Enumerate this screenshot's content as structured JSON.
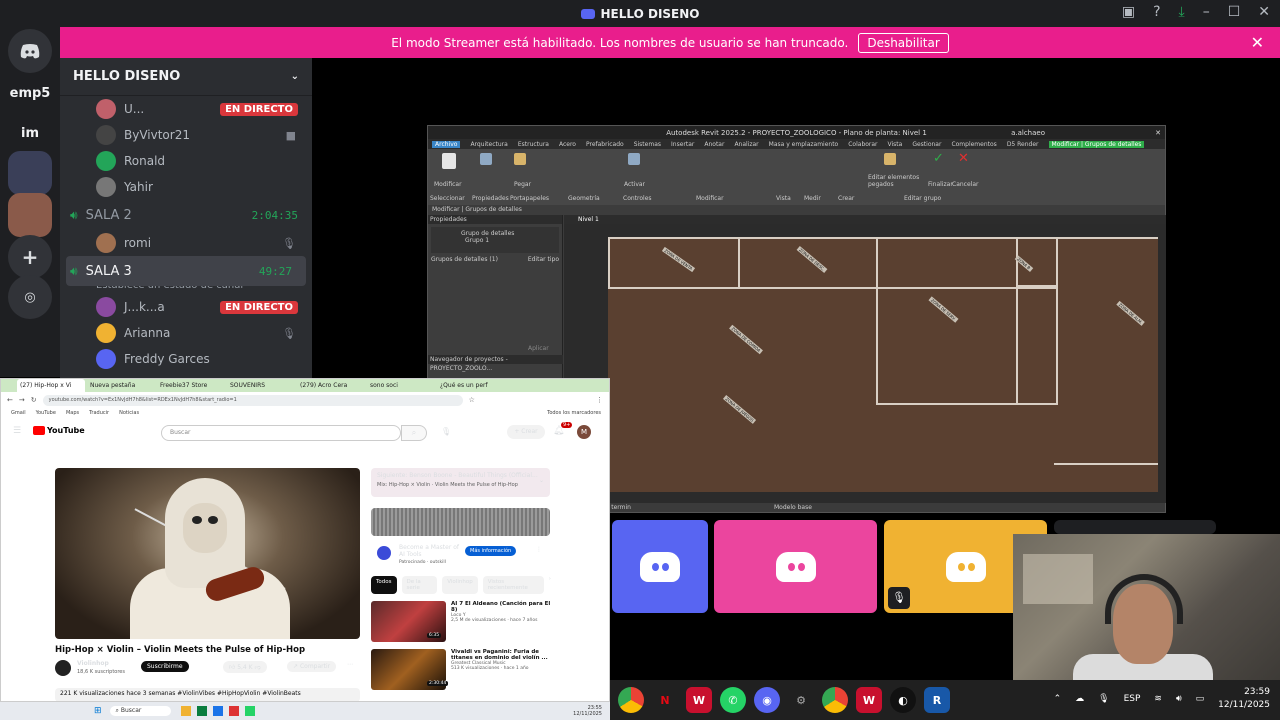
{
  "window": {
    "title": "HELLO DISENO"
  },
  "banner": {
    "message": "El modo Streamer está habilitado. Los nombres de usuario se han truncado.",
    "button": "Deshabilitar"
  },
  "rail": {
    "items": [
      "emp5",
      "im"
    ]
  },
  "sidebar": {
    "guild": "HELLO DISENO",
    "top_users": [
      {
        "name": "U...",
        "live": "EN DIRECTO"
      },
      {
        "name": "ByVivtor21"
      },
      {
        "name": "Ronald"
      },
      {
        "name": "Yahir"
      }
    ],
    "sala2": {
      "name": "SALA 2",
      "time": "2:04:35",
      "users": [
        {
          "name": "romi"
        }
      ]
    },
    "sala3": {
      "name": "SALA 3",
      "time": "49:27",
      "status": "Establece un estado de canal",
      "users": [
        {
          "name": "J...k...a",
          "live": "EN DIRECTO"
        },
        {
          "name": "Arianna"
        },
        {
          "name": "Freddy Garces"
        }
      ]
    }
  },
  "revit": {
    "title": "Autodesk Revit 2025.2 - PROYECTO_ZOOLOGICO - Plano de planta: Nivel 1",
    "user": "a.alchaeo",
    "tabs": [
      "Archivo",
      "Arquitectura",
      "Estructura",
      "Acero",
      "Prefabricado",
      "Sistemas",
      "Insertar",
      "Anotar",
      "Analizar",
      "Masa y emplazamiento",
      "Colaborar",
      "Vista",
      "Gestionar",
      "Complementos",
      "D5 Render",
      "Modificar | Grupos de detalles"
    ],
    "groups": [
      "Seleccionar",
      "Propiedades",
      "Portapapeles",
      "Geometría",
      "Controles",
      "Modificar",
      "Vista",
      "Medir",
      "Crear",
      "Editar grupo"
    ],
    "ribbon_labels": [
      "Modificar",
      "Pegar",
      "Activar",
      "Editar elementos pegados",
      "Finalizar",
      "Cancelar"
    ],
    "path": "Modificar | Grupos de detalles",
    "properties_title": "Propiedades",
    "prop_type": "Grupo de detalles",
    "prop_subtype": "Grupo 1",
    "prop_filter": "Grupos de detalles (1)",
    "edit_type": "Editar tipo",
    "apply": "Aplicar",
    "navigator": "Navegador de proyectos - PROYECTO_ZOOLO...",
    "view_tab": "Nivel 1",
    "status_left": "ver vista). Para termin",
    "status_mid": "Modelo base"
  },
  "chrome": {
    "tabs": [
      "(27) Hip-Hop x Vi",
      "Nueva pestaña",
      "Freebie37 Store",
      "SOUVENIRS",
      "(279) Acro Cera",
      "sono soci",
      "¿Qué es un perf"
    ],
    "url": "youtube.com/watch?v=Ex1NvJdH7h8&list=RDEx1NvJdH7h8&start_radio=1",
    "bookmarks": [
      "Gmail",
      "YouTube",
      "Maps",
      "Traducir",
      "Noticias"
    ],
    "all_bookmarks": "Todos los marcadores"
  },
  "youtube": {
    "logo": "YouTube",
    "search_placeholder": "Buscar",
    "create": "+ Crear",
    "notif_count": "9+",
    "avatar": "M",
    "video_title": "Hip-Hop × Violin – Violin Meets the Pulse of Hip-Hop",
    "channel": "Violinhop",
    "subs": "18,6 K suscriptores",
    "subscribe": "Suscribirme",
    "likes": "5,4 K",
    "share": "Compartir",
    "description": "221 K visualizaciones  hace 3 semanas  #ViolinVibes #HipHopViolin #ViolinBeats",
    "next_up": {
      "label": "Siguiente: Benson Boone - Beautiful Things (Official...",
      "sub": "Mix: Hip-Hop × Violin · Violin Meets the Pulse of Hip-Hop"
    },
    "ad": {
      "title": "Become a Master of AI Tools",
      "sponsor": "Patrocinado · outskill",
      "cta": "Más información"
    },
    "chips": [
      "Todos",
      "De la serie",
      "Violinhop",
      "Vistos recientemente"
    ],
    "recs": [
      {
        "title": "AI 7 El Aldeano (Canción para El 8)",
        "channel": "Loco Y",
        "meta": "2,5 M de visualizaciones · hace 7 años",
        "dur": "6:35"
      },
      {
        "title": "Vivaldi vs Paganini: Furia de titanes en dominio del violín ...",
        "channel": "Greatest Classical Music",
        "meta": "513 K visualizaciones · hace 1 año",
        "dur": "2:30:44"
      }
    ]
  },
  "chrome_taskbar": {
    "search": "Buscar",
    "time": "23:55",
    "date": "12/11/2025"
  },
  "taskbar": {
    "lang": "ESP",
    "time": "23:59",
    "date": "12/11/2025",
    "revit_badge": "R"
  },
  "colors": {
    "discord": "#5865f2",
    "pink": "#eb459e",
    "gold": "#f0b232",
    "streamer": "#e91e8c"
  }
}
